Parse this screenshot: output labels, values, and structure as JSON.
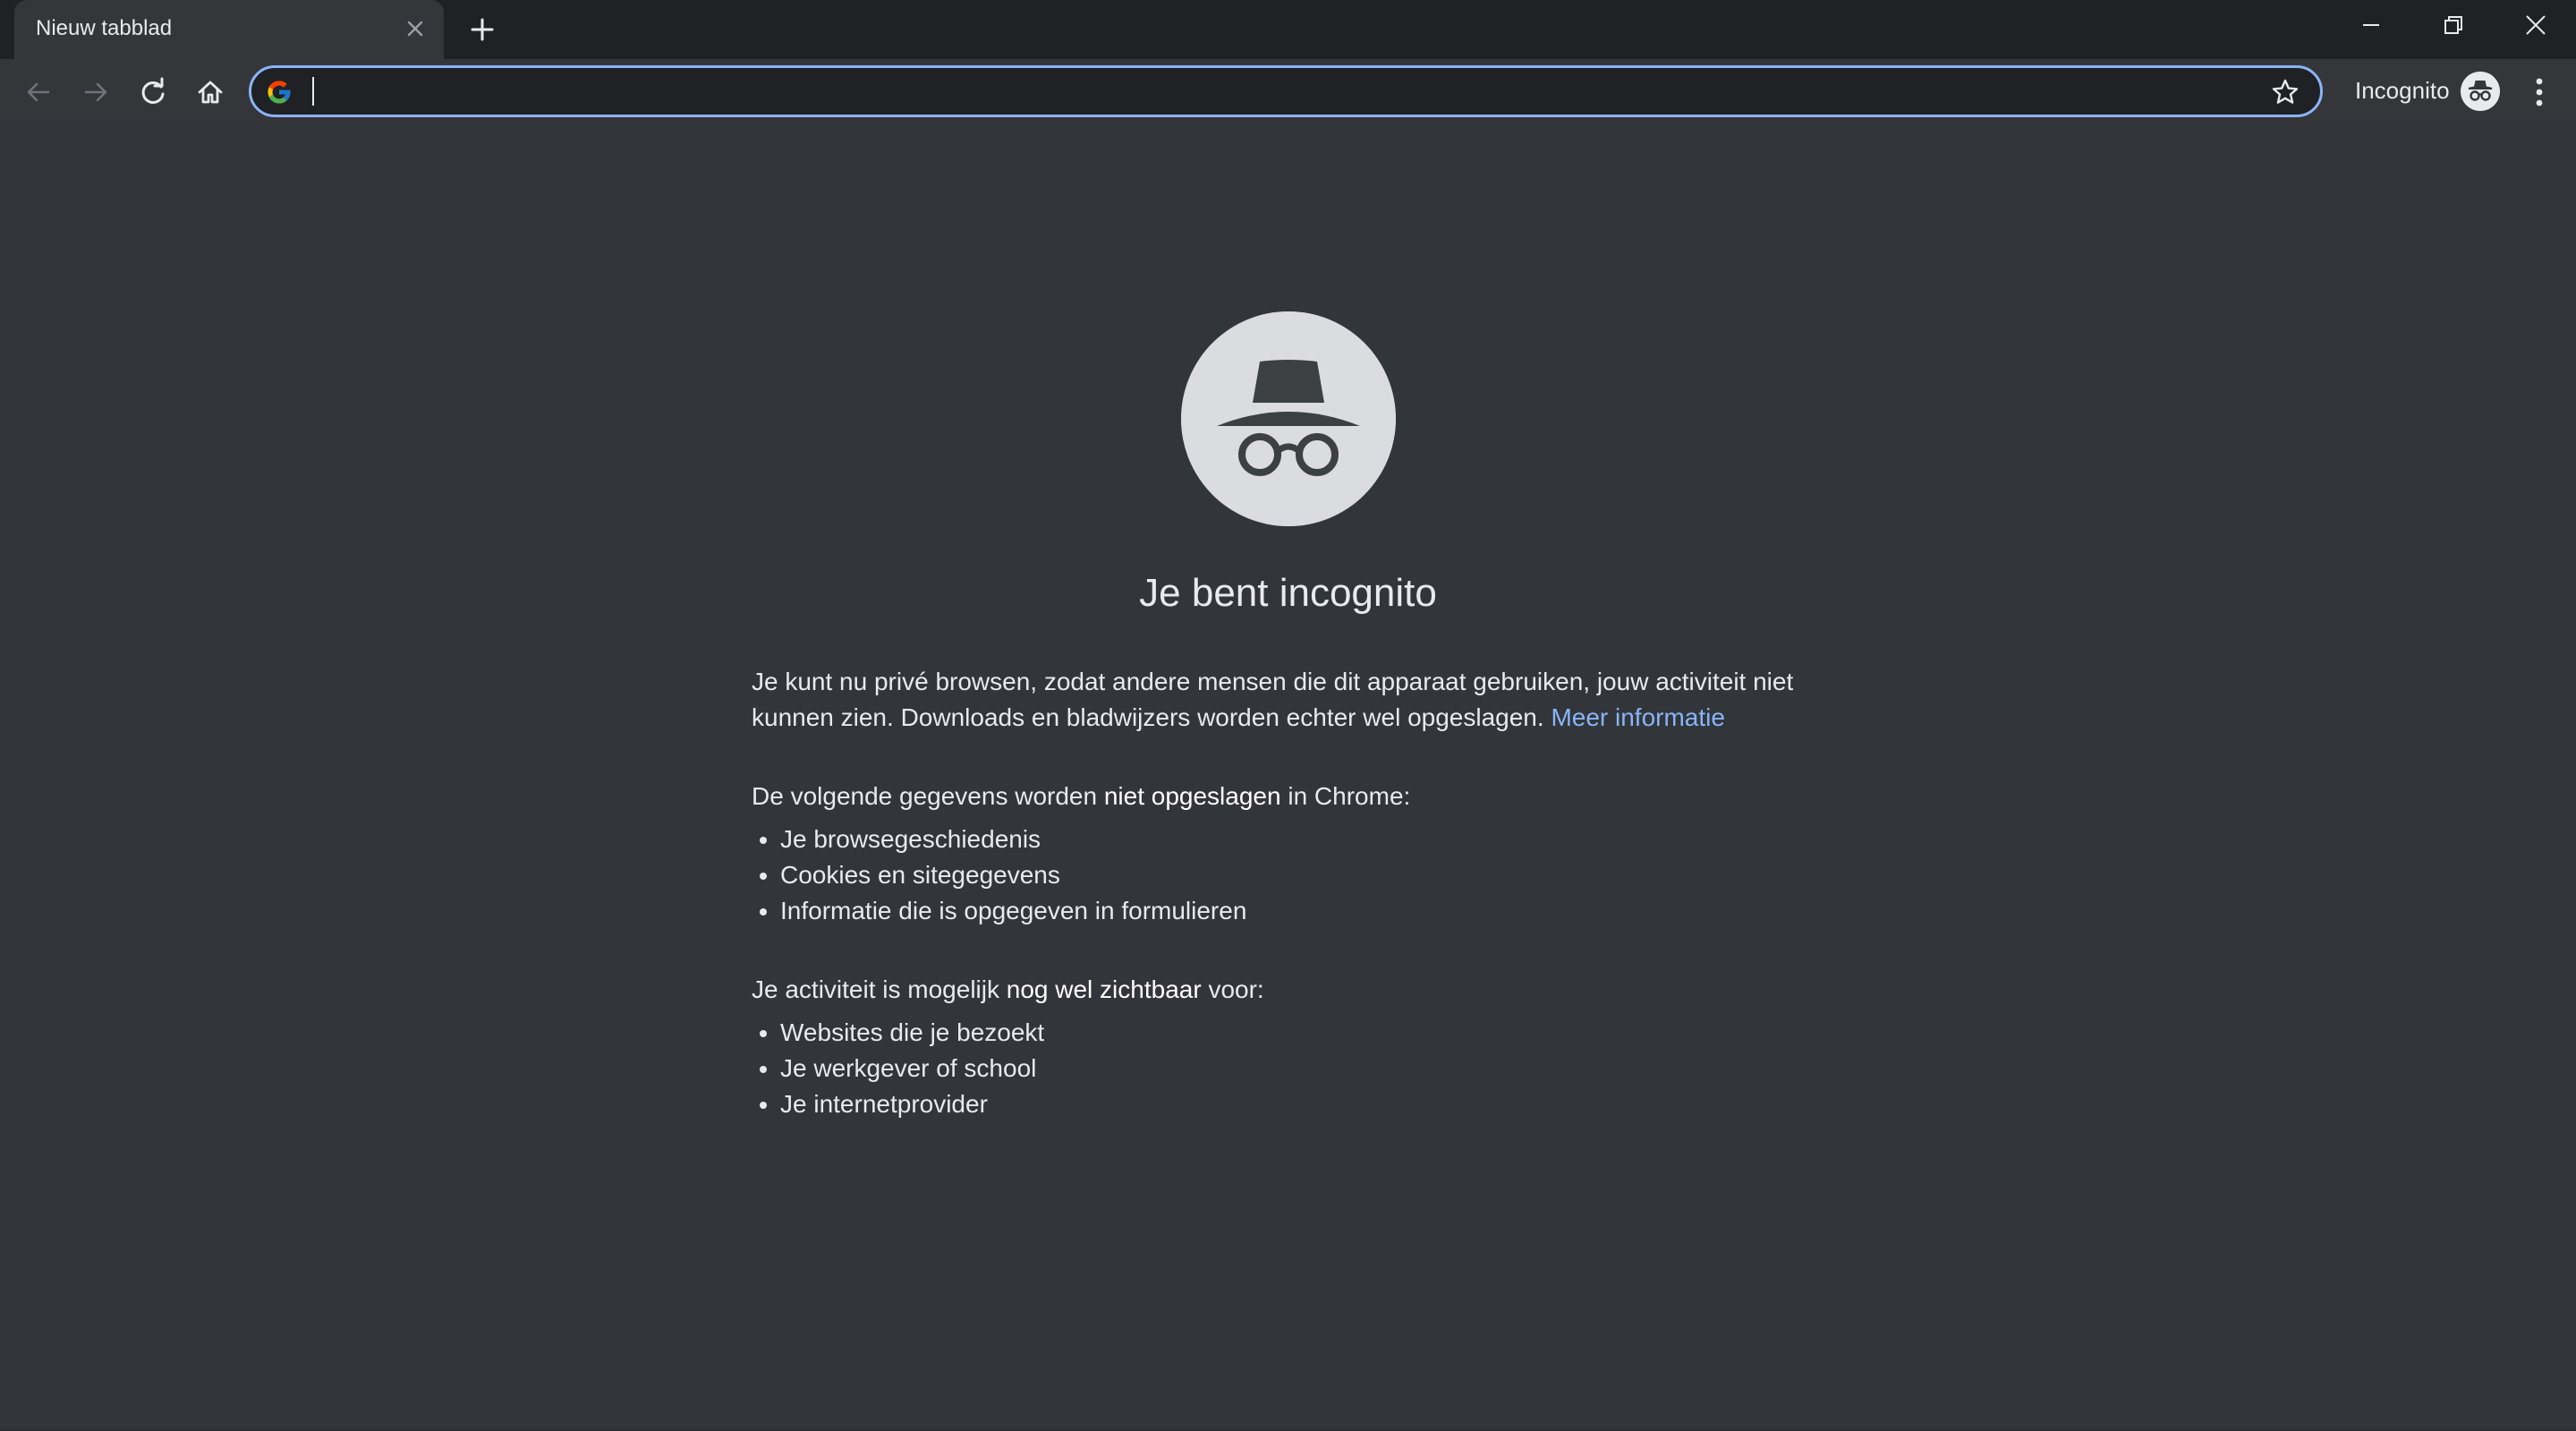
{
  "window": {
    "minimize_icon": "minimize-icon",
    "maximize_icon": "restore-icon",
    "close_icon": "close-icon"
  },
  "tabs": [
    {
      "title": "Nieuw tabblad",
      "active": true
    }
  ],
  "toolbar": {
    "omnibox": {
      "value": "",
      "placeholder": "",
      "leading_icon": "google-g-icon",
      "trailing_icon": "star-icon"
    },
    "profile_label": "Incognito",
    "profile_icon": "incognito-icon"
  },
  "page": {
    "heading": "Je bent incognito",
    "intro_text": "Je kunt nu privé browsen, zodat andere mensen die dit apparaat gebruiken, jouw activiteit niet kunnen zien. Downloads en bladwijzers worden echter wel opgeslagen.",
    "intro_link": "Meer informatie",
    "not_saved": {
      "title_before": "De volgende gegevens worden ",
      "title_strong": "niet opgeslagen",
      "title_after": " in Chrome:",
      "items": [
        "Je browsegeschiedenis",
        "Cookies en sitegegevens",
        "Informatie die is opgegeven in formulieren"
      ]
    },
    "still_visible": {
      "title_before": "Je activiteit is mogelijk ",
      "title_strong": "nog wel zichtbaar",
      "title_after": " voor:",
      "items": [
        "Websites die je bezoekt",
        "Je werkgever of school",
        "Je internetprovider"
      ]
    }
  },
  "colors": {
    "page_background": "#32363a",
    "toolbar_background": "#35363a",
    "titlebar_background": "#202124",
    "text": "#e8eaed",
    "link": "#8ab4f8",
    "icon_circle": "#dadce0"
  }
}
